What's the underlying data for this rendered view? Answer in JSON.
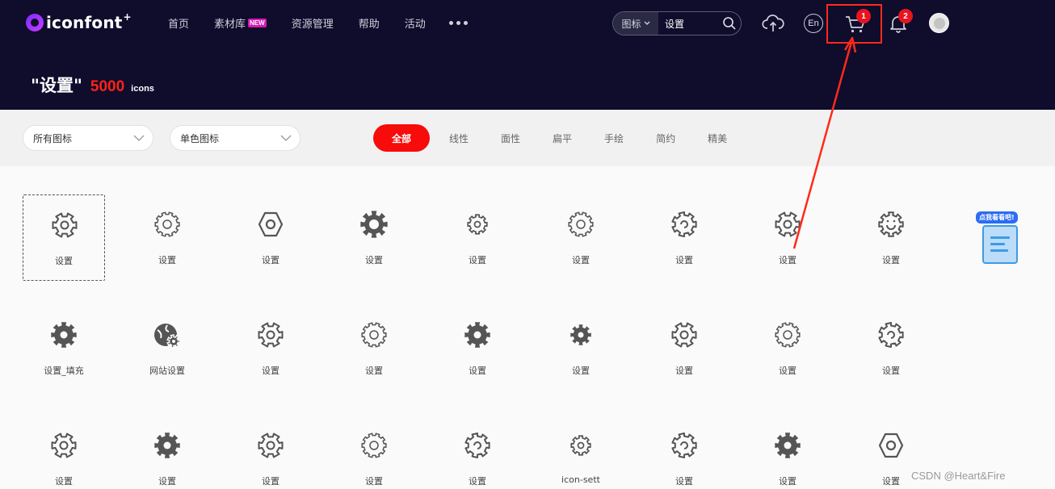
{
  "brand": {
    "name": "iconfont",
    "mark": "+"
  },
  "nav": {
    "items": [
      {
        "label": "首页"
      },
      {
        "label": "素材库",
        "badge": "NEW"
      },
      {
        "label": "资源管理"
      },
      {
        "label": "帮助"
      },
      {
        "label": "活动"
      }
    ]
  },
  "search": {
    "type": "图标",
    "value": "设置"
  },
  "header": {
    "lang": "En",
    "cart_count": "1",
    "notification_count": "2"
  },
  "title": {
    "keyword": "\"设置\"",
    "count": "5000",
    "unit": "icons"
  },
  "filters": {
    "category": "所有图标",
    "color": "单色图标"
  },
  "tabs": [
    "全部",
    "线性",
    "面性",
    "扁平",
    "手绘",
    "简约",
    "精美"
  ],
  "icons": [
    {
      "label": "设置",
      "style": "gear-outline"
    },
    {
      "label": "设置",
      "style": "gear-thin"
    },
    {
      "label": "设置",
      "style": "hexagon"
    },
    {
      "label": "设置",
      "style": "gear-bold"
    },
    {
      "label": "设置",
      "style": "gear-small"
    },
    {
      "label": "设置",
      "style": "gear-thin"
    },
    {
      "label": "设置",
      "style": "gear-open"
    },
    {
      "label": "设置",
      "style": "gear-outline"
    },
    {
      "label": "设置",
      "style": "gear-smile"
    },
    {
      "label": "设置_填充",
      "style": "gear-filled"
    },
    {
      "label": "网站设置",
      "style": "globe-gear"
    },
    {
      "label": "设置",
      "style": "gear-outline"
    },
    {
      "label": "设置",
      "style": "gear-thin"
    },
    {
      "label": "设置",
      "style": "gear-filled"
    },
    {
      "label": "设置",
      "style": "gear-filled-small"
    },
    {
      "label": "设置",
      "style": "gear-outline"
    },
    {
      "label": "设置",
      "style": "gear-thin"
    },
    {
      "label": "设置",
      "style": "gear-open"
    },
    {
      "label": "设置",
      "style": "gear-outline"
    },
    {
      "label": "设置",
      "style": "gear-filled"
    },
    {
      "label": "设置",
      "style": "gear-outline"
    },
    {
      "label": "设置",
      "style": "gear-thin"
    },
    {
      "label": "设置",
      "style": "gear-open"
    },
    {
      "label": "icon-sett",
      "style": "gear-small"
    },
    {
      "label": "设置",
      "style": "gear-open"
    },
    {
      "label": "设置",
      "style": "gear-filled"
    },
    {
      "label": "设置",
      "style": "hexagon"
    }
  ],
  "promo": {
    "text": "点我看看吧!"
  },
  "watermark": "CSDN @Heart&Fire",
  "colors": {
    "header_bg": "#0f0c2c",
    "accent_red": "#f70b0b",
    "badge_red": "#e8141e",
    "icon_gray": "#555555"
  }
}
